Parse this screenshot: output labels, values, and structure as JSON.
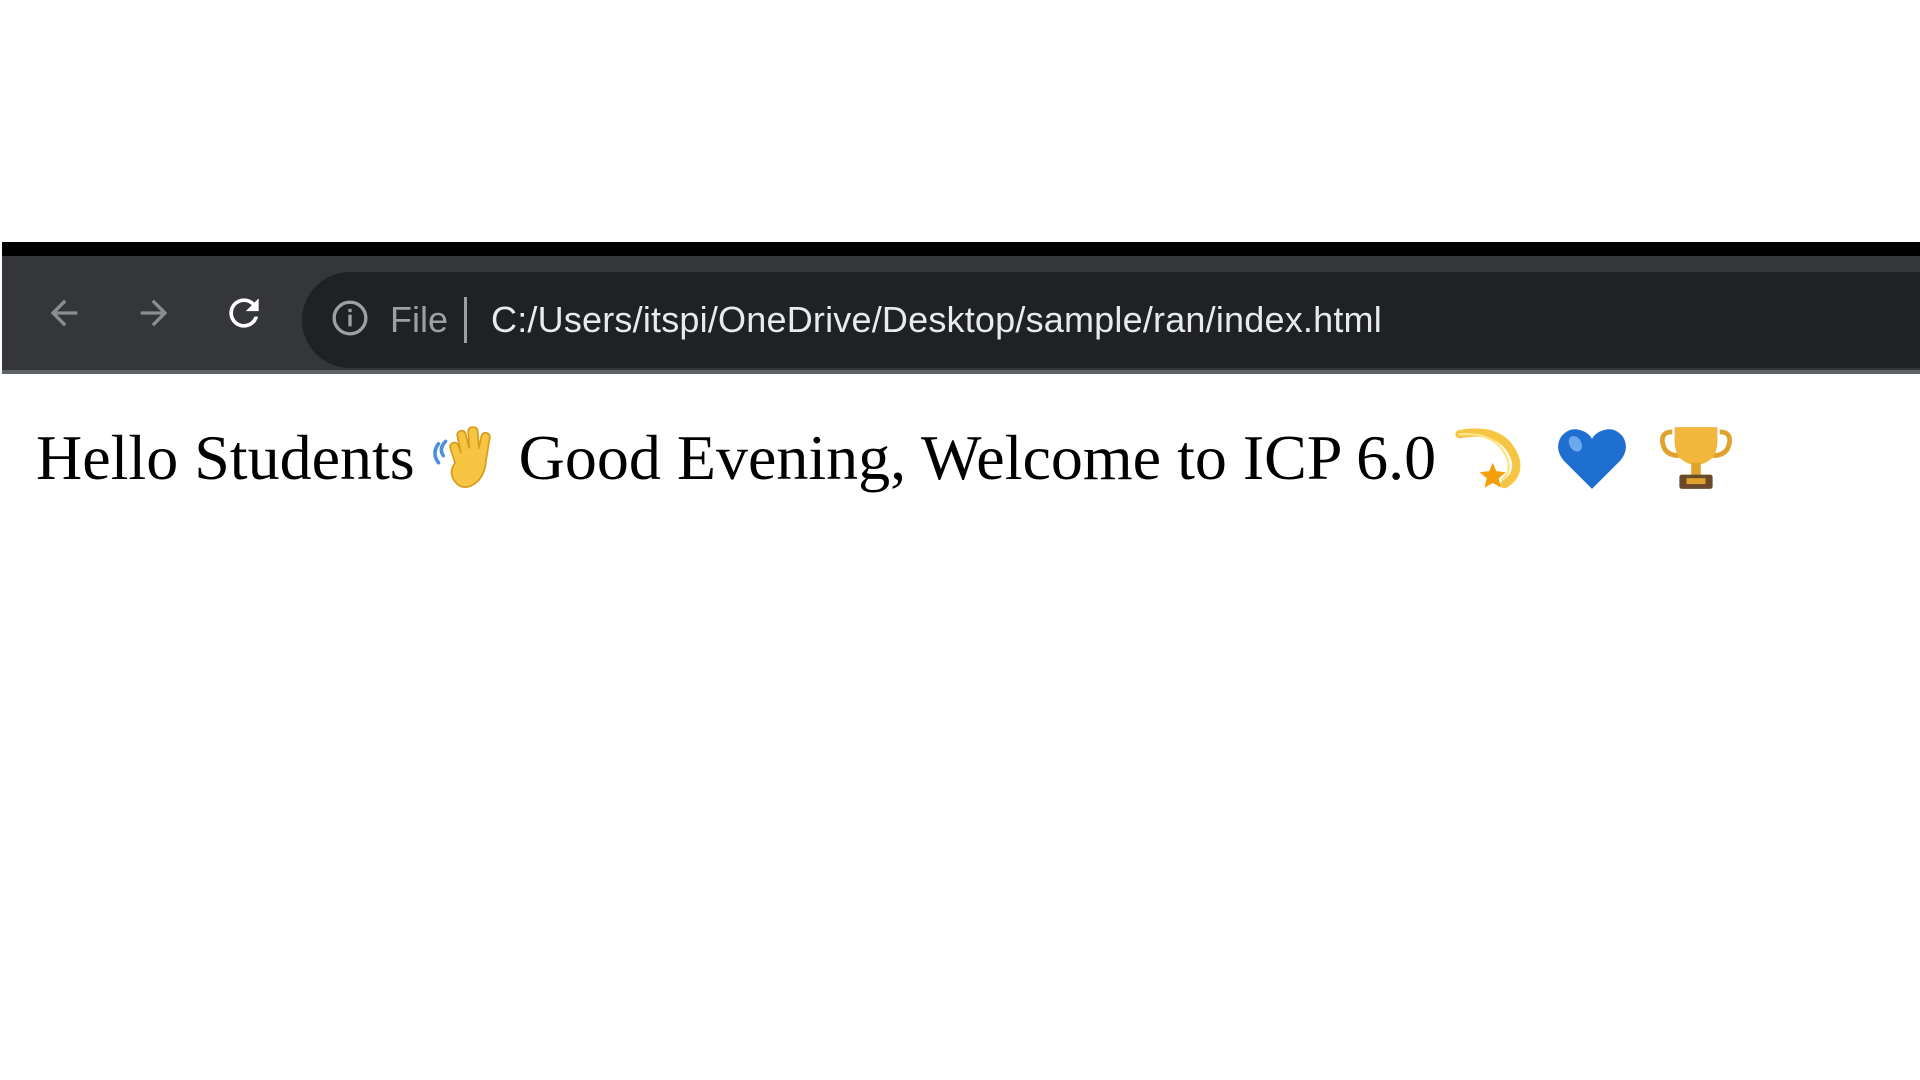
{
  "browser": {
    "address_bar": {
      "scheme_label": "File",
      "url": "C:/Users/itspi/OneDrive/Desktop/sample/ran/index.html"
    },
    "icons": {
      "back": "back-arrow-icon",
      "forward": "forward-arrow-icon",
      "reload": "reload-icon",
      "site_info": "info-icon"
    },
    "colors": {
      "toolbar": "#35363a",
      "omnibox": "#202124",
      "url_text": "#e8eaed",
      "muted_text": "#9aa0a6"
    }
  },
  "page": {
    "heading": {
      "part1": "Hello Students",
      "part2": "Good Evening, Welcome to ICP 6.0",
      "emojis": [
        "waving-hand-icon",
        "dizzy-icon",
        "blue-heart-icon",
        "trophy-icon"
      ]
    }
  }
}
